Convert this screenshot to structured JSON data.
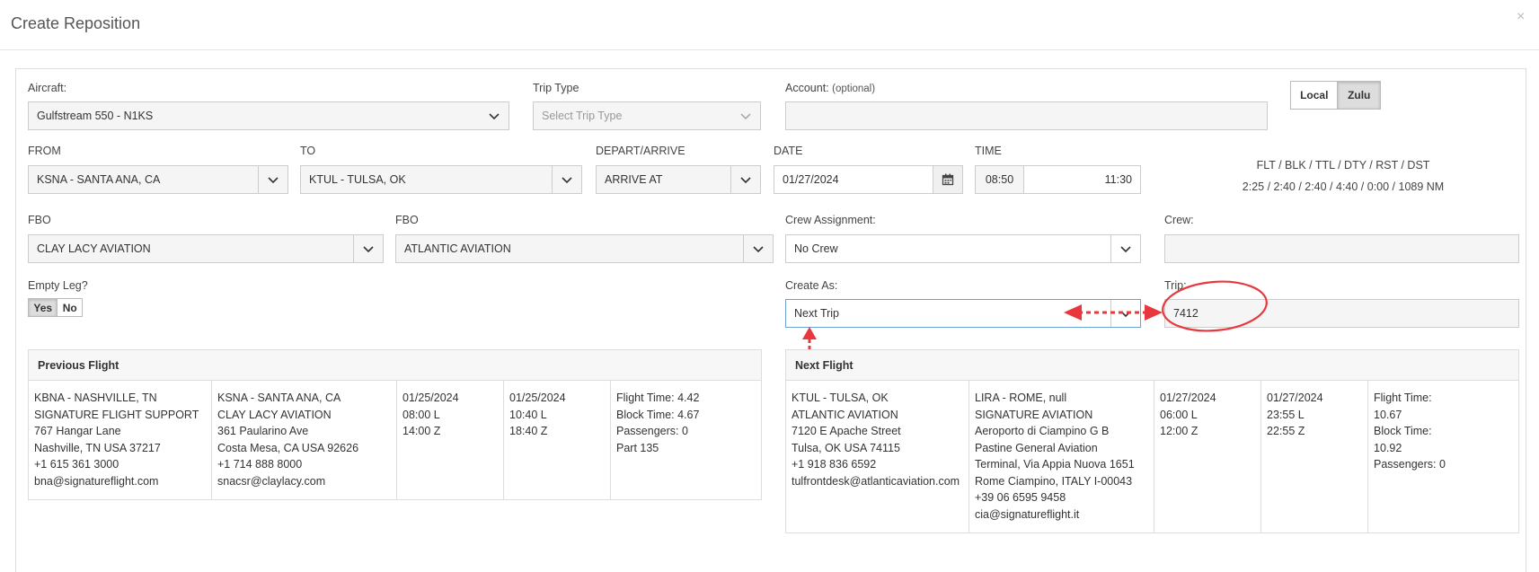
{
  "dialog": {
    "title": "Create Reposition",
    "close_glyph": "×"
  },
  "aircraft": {
    "label": "Aircraft:",
    "value": "Gulfstream 550 - N1KS"
  },
  "trip_type": {
    "label": "Trip Type",
    "placeholder": "Select Trip Type"
  },
  "account": {
    "label": "Account:",
    "hint": "(optional)",
    "value": ""
  },
  "time_mode": {
    "options": [
      "Local",
      "Zulu"
    ],
    "selected": "Zulu"
  },
  "from": {
    "label": "FROM",
    "value": "KSNA - SANTA ANA, CA"
  },
  "to": {
    "label": "TO",
    "value": "KTUL - TULSA, OK"
  },
  "depart_arrive": {
    "label": "DEPART/ARRIVE",
    "value": "ARRIVE AT"
  },
  "date": {
    "label": "DATE",
    "value": "01/27/2024",
    "icon": "calendar-icon"
  },
  "time": {
    "label": "TIME",
    "local": "08:50",
    "zulu": "11:30"
  },
  "stats": {
    "header": "FLT / BLK / TTL / DTY / RST / DST",
    "values": "2:25 / 2:40 / 2:40 / 4:40 / 0:00 / 1089 NM"
  },
  "fbo_from": {
    "label": "FBO",
    "value": "CLAY LACY AVIATION"
  },
  "fbo_to": {
    "label": "FBO",
    "value": "ATLANTIC AVIATION"
  },
  "crew_assignment": {
    "label": "Crew Assignment:",
    "value": "No Crew"
  },
  "crew": {
    "label": "Crew:",
    "value": ""
  },
  "empty_leg": {
    "label": "Empty Leg?",
    "options": [
      "Yes",
      "No"
    ],
    "selected": "Yes"
  },
  "create_as": {
    "label": "Create As:",
    "value": "Next Trip"
  },
  "trip": {
    "label": "Trip:",
    "value": "7412"
  },
  "annotation": {
    "color": "#e8383d"
  },
  "previous_flight": {
    "title": "Previous Flight",
    "cells": [
      [
        "KBNA - NASHVILLE, TN",
        "SIGNATURE FLIGHT SUPPORT",
        "767 Hangar Lane",
        "Nashville, TN USA 37217",
        "+1 615 361 3000",
        "bna@signatureflight.com"
      ],
      [
        "KSNA - SANTA ANA, CA",
        "CLAY LACY AVIATION",
        "361 Paularino Ave",
        "Costa Mesa, CA USA 92626",
        "+1 714 888 8000",
        "snacsr@claylacy.com"
      ],
      [
        "01/25/2024",
        "08:00 L",
        "14:00 Z"
      ],
      [
        "01/25/2024",
        "10:40 L",
        "18:40 Z"
      ],
      [
        "Flight Time: 4.42",
        "Block Time: 4.67",
        "Passengers: 0",
        "Part 135"
      ]
    ]
  },
  "next_flight": {
    "title": "Next Flight",
    "cells": [
      [
        "KTUL - TULSA, OK",
        "ATLANTIC AVIATION",
        "7120 E Apache Street",
        "Tulsa, OK USA 74115",
        "+1 918 836 6592",
        "tulfrontdesk@atlanticaviation.com"
      ],
      [
        "LIRA - ROME, null",
        "SIGNATURE AVIATION",
        "Aeroporto di Ciampino G B",
        "Pastine General Aviation",
        "Terminal, Via Appia Nuova 1651",
        "Rome Ciampino, ITALY I-00043",
        "+39 06 6595 9458",
        "cia@signatureflight.it"
      ],
      [
        "01/27/2024",
        "06:00 L",
        "12:00 Z"
      ],
      [
        "01/27/2024",
        "23:55 L",
        "22:55 Z"
      ],
      [
        "Flight Time:",
        "10.67",
        "Block Time:",
        "10.92",
        "Passengers: 0"
      ]
    ]
  }
}
